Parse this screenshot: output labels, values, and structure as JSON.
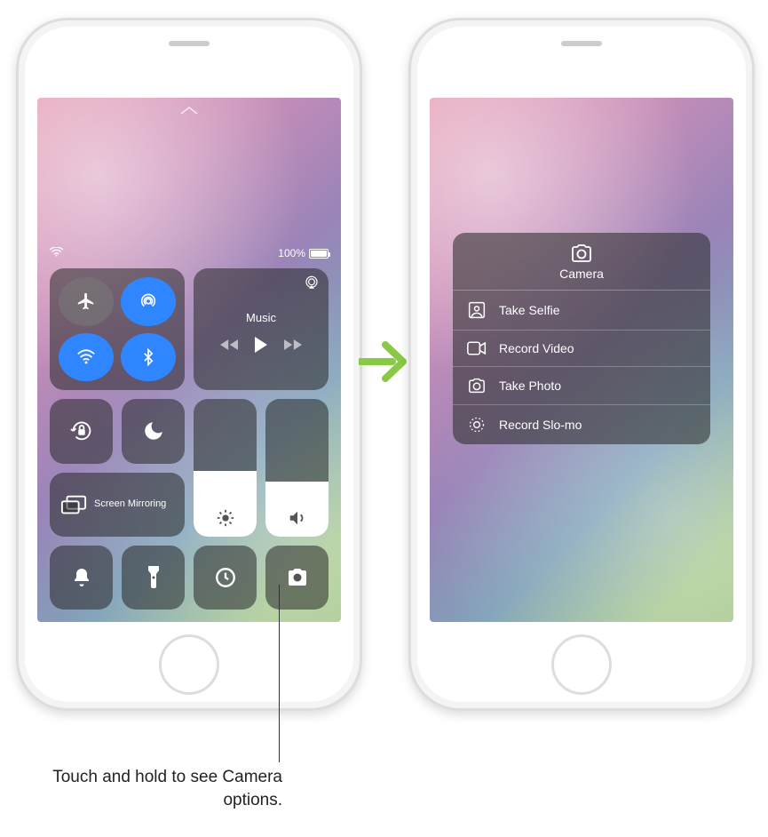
{
  "status": {
    "battery_text": "100%",
    "battery_level": 100
  },
  "music": {
    "label": "Music"
  },
  "screen_mirroring": {
    "label": "Screen Mirroring"
  },
  "camera_menu": {
    "title": "Camera",
    "items": [
      {
        "label": "Take Selfie"
      },
      {
        "label": "Record Video"
      },
      {
        "label": "Take Photo"
      },
      {
        "label": "Record Slo-mo"
      }
    ]
  },
  "callout": {
    "text": "Touch and hold to see Camera options."
  },
  "sliders": {
    "brightness_percent": 48,
    "volume_percent": 40
  },
  "connectivity": {
    "airplane": false,
    "airdrop": true,
    "wifi": true,
    "bluetooth": true
  }
}
